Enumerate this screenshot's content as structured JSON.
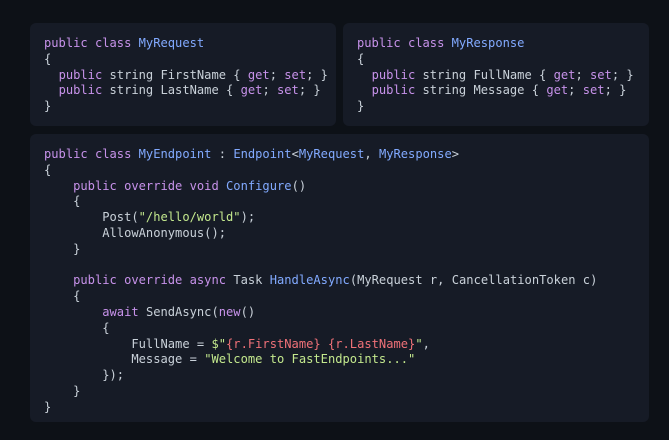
{
  "colors": {
    "background": "#0d1117",
    "panel": "#161b26",
    "keyword": "#c792ea",
    "type": "#82aaff",
    "string": "#c3e88d",
    "interpolation": "#f07178",
    "plain": "#c9d1d9"
  },
  "panels": [
    {
      "name": "request",
      "lines": [
        [
          [
            "kw",
            "public class "
          ],
          [
            "type",
            "MyRequest"
          ]
        ],
        [
          [
            "plain",
            "{"
          ]
        ],
        [
          [
            "plain",
            "  "
          ],
          [
            "kw",
            "public "
          ],
          [
            "plain",
            "string "
          ],
          [
            "plain",
            "FirstName { "
          ],
          [
            "kw",
            "get"
          ],
          [
            "plain",
            "; "
          ],
          [
            "kw",
            "set"
          ],
          [
            "plain",
            "; }"
          ]
        ],
        [
          [
            "plain",
            "  "
          ],
          [
            "kw",
            "public "
          ],
          [
            "plain",
            "string "
          ],
          [
            "plain",
            "LastName { "
          ],
          [
            "kw",
            "get"
          ],
          [
            "plain",
            "; "
          ],
          [
            "kw",
            "set"
          ],
          [
            "plain",
            "; }"
          ]
        ],
        [
          [
            "plain",
            "}"
          ]
        ]
      ]
    },
    {
      "name": "response",
      "lines": [
        [
          [
            "kw",
            "public class "
          ],
          [
            "type",
            "MyResponse"
          ]
        ],
        [
          [
            "plain",
            "{"
          ]
        ],
        [
          [
            "plain",
            "  "
          ],
          [
            "kw",
            "public "
          ],
          [
            "plain",
            "string "
          ],
          [
            "plain",
            "FullName { "
          ],
          [
            "kw",
            "get"
          ],
          [
            "plain",
            "; "
          ],
          [
            "kw",
            "set"
          ],
          [
            "plain",
            "; }"
          ]
        ],
        [
          [
            "plain",
            "  "
          ],
          [
            "kw",
            "public "
          ],
          [
            "plain",
            "string "
          ],
          [
            "plain",
            "Message { "
          ],
          [
            "kw",
            "get"
          ],
          [
            "plain",
            "; "
          ],
          [
            "kw",
            "set"
          ],
          [
            "plain",
            "; }"
          ]
        ],
        [
          [
            "plain",
            "}"
          ]
        ]
      ]
    },
    {
      "name": "endpoint",
      "lines": [
        [
          [
            "kw",
            "public class "
          ],
          [
            "type",
            "MyEndpoint"
          ],
          [
            "plain",
            " : "
          ],
          [
            "type",
            "Endpoint"
          ],
          [
            "plain",
            "<"
          ],
          [
            "type",
            "MyRequest"
          ],
          [
            "plain",
            ", "
          ],
          [
            "type",
            "MyResponse"
          ],
          [
            "plain",
            ">"
          ]
        ],
        [
          [
            "plain",
            "{"
          ]
        ],
        [
          [
            "plain",
            "    "
          ],
          [
            "kw",
            "public override void "
          ],
          [
            "type",
            "Configure"
          ],
          [
            "plain",
            "()"
          ]
        ],
        [
          [
            "plain",
            "    {"
          ]
        ],
        [
          [
            "plain",
            "        Post("
          ],
          [
            "str",
            "\"/hello/world\""
          ],
          [
            "plain",
            ");"
          ]
        ],
        [
          [
            "plain",
            "        AllowAnonymous();"
          ]
        ],
        [
          [
            "plain",
            "    }"
          ]
        ],
        [
          [
            "plain",
            ""
          ]
        ],
        [
          [
            "plain",
            "    "
          ],
          [
            "kw",
            "public override async "
          ],
          [
            "plain",
            "Task "
          ],
          [
            "type",
            "HandleAsync"
          ],
          [
            "plain",
            "(MyRequest r, CancellationToken c)"
          ]
        ],
        [
          [
            "plain",
            "    {"
          ]
        ],
        [
          [
            "plain",
            "        "
          ],
          [
            "kw",
            "await "
          ],
          [
            "plain",
            "SendAsync("
          ],
          [
            "kw",
            "new"
          ],
          [
            "plain",
            "()"
          ]
        ],
        [
          [
            "plain",
            "        {"
          ]
        ],
        [
          [
            "plain",
            "            FullName = "
          ],
          [
            "str",
            "$\""
          ],
          [
            "interp",
            "{r.FirstName}"
          ],
          [
            "str",
            " "
          ],
          [
            "interp",
            "{r.LastName}"
          ],
          [
            "str",
            "\""
          ],
          [
            "plain",
            ","
          ]
        ],
        [
          [
            "plain",
            "            Message = "
          ],
          [
            "str",
            "\"Welcome to FastEndpoints...\""
          ]
        ],
        [
          [
            "plain",
            "        });"
          ]
        ],
        [
          [
            "plain",
            "    }"
          ]
        ],
        [
          [
            "plain",
            "}"
          ]
        ]
      ]
    }
  ]
}
